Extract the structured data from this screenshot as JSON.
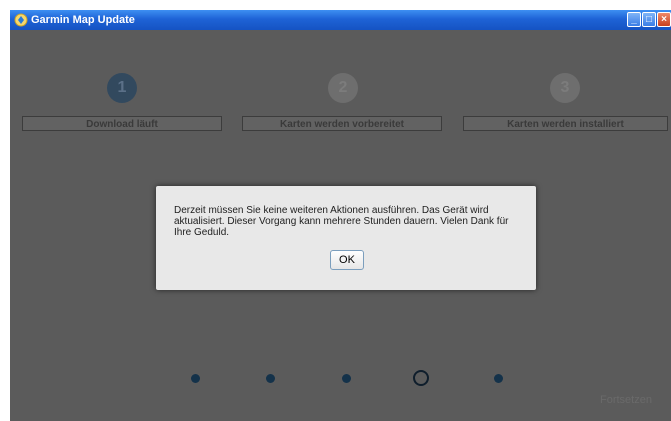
{
  "window": {
    "title": "Garmin Map Update"
  },
  "steps": [
    {
      "number": "1",
      "label": "Download läuft",
      "state": "active"
    },
    {
      "number": "2",
      "label": "Karten werden vorbereitet",
      "state": "inactive"
    },
    {
      "number": "3",
      "label": "Karten werden installiert",
      "state": "inactive"
    }
  ],
  "dialog": {
    "message": "Derzeit müssen Sie keine weiteren Aktionen ausführen. Das Gerät wird aktualisiert. Dieser Vorgang kann mehrere Stunden dauern. Vielen Dank für Ihre Geduld.",
    "ok_label": "OK"
  },
  "pager": {
    "total": 5,
    "current": 4
  },
  "footer": {
    "next_label": "Fortsetzen"
  },
  "colors": {
    "titlebar": "#1e63d6",
    "overlay": "#5b5b5b",
    "dialog_bg": "#e8e8e8",
    "active_step": "#32495e",
    "dot": "#14324a"
  }
}
